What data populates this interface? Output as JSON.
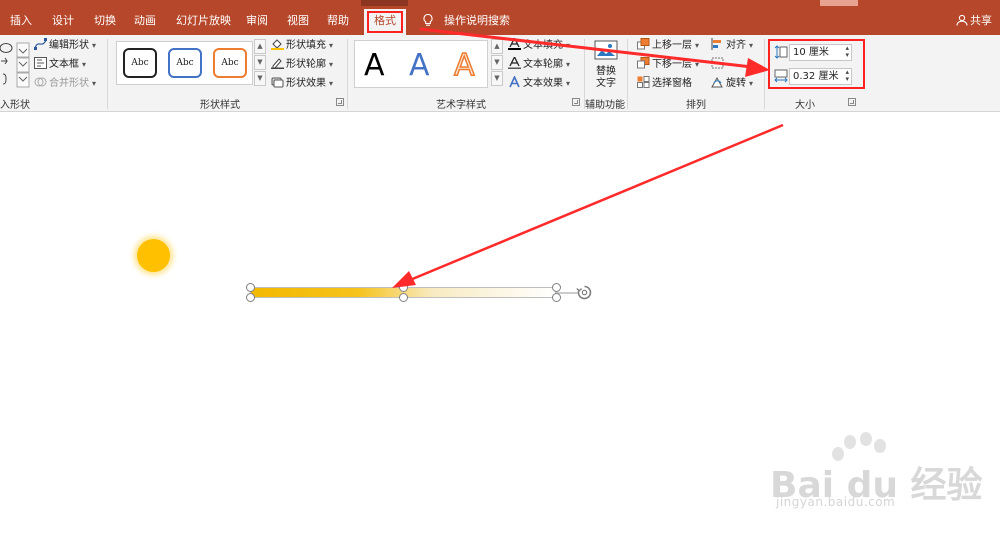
{
  "tabs": [
    "插入",
    "设计",
    "切换",
    "动画",
    "幻灯片放映",
    "审阅",
    "视图",
    "帮助",
    "格式"
  ],
  "tell_me": "操作说明搜索",
  "share": "共享",
  "insert_shapes": {
    "edit_shape": "编辑形状",
    "text_box": "文本框",
    "merge_shapes": "合并形状",
    "label": "入形状"
  },
  "shape_styles": {
    "samples": [
      "Abc",
      "Abc",
      "Abc"
    ],
    "fill": "形状填充",
    "outline": "形状轮廓",
    "effects": "形状效果",
    "label": "形状样式"
  },
  "wordart": {
    "samples": [
      "A",
      "A",
      "A"
    ],
    "text_fill": "文本填充",
    "text_outline": "文本轮廓",
    "text_effects": "文本效果",
    "label": "艺术字样式"
  },
  "accessibility": {
    "alt_text_line1": "替换",
    "alt_text_line2": "文字",
    "label": "辅助功能"
  },
  "arrange": {
    "bring_forward": "上移一层",
    "send_backward": "下移一层",
    "selection_pane": "选择窗格",
    "align": "对齐",
    "rotate": "旋转",
    "label": "排列"
  },
  "size": {
    "height": "10 厘米",
    "width": "0.32 厘米",
    "label": "大小"
  },
  "watermark": {
    "brand": "Bai du 经验",
    "url": "jingyan.baidu.com"
  },
  "colors": {
    "accent": "#b7472a",
    "highlight": "#ff2020",
    "shape_fill": "#ffc000"
  }
}
